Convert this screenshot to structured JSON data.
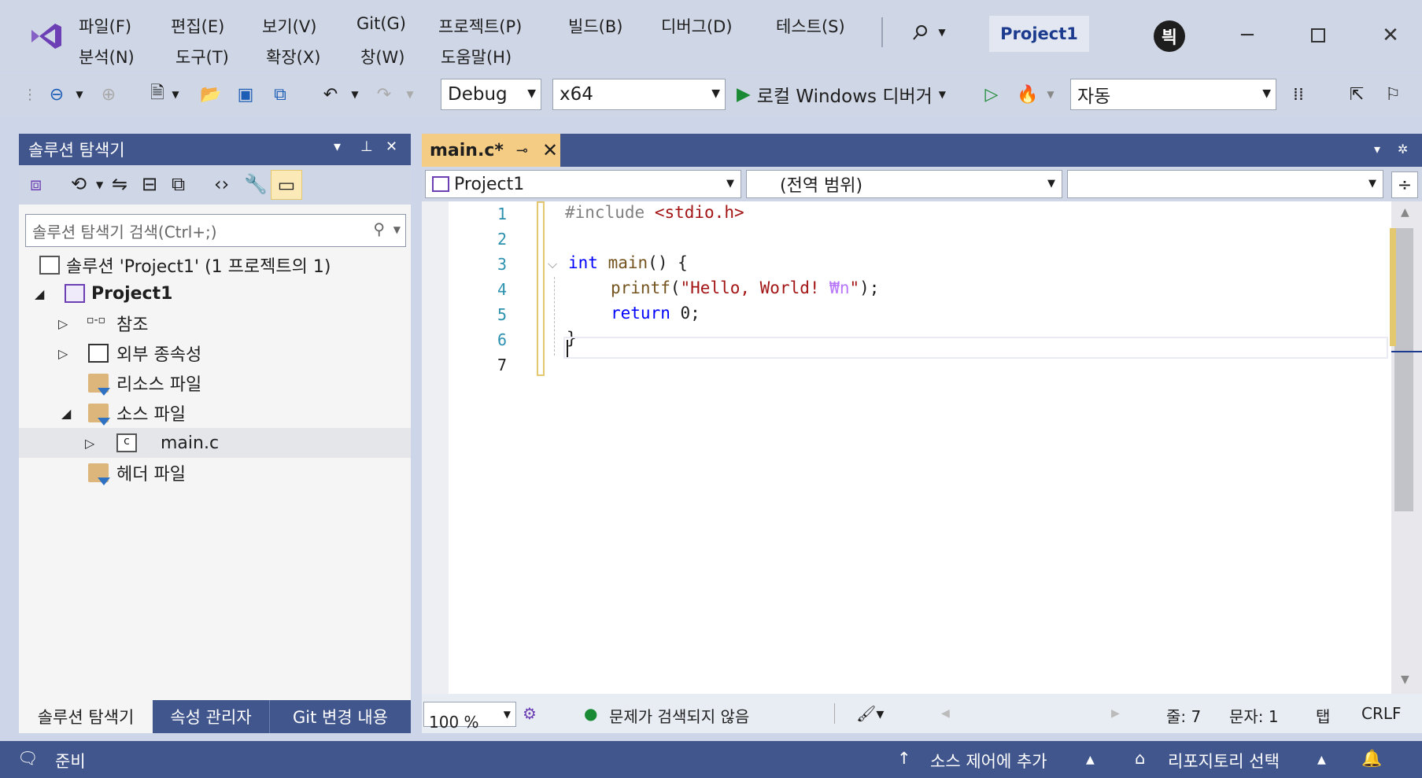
{
  "menu": {
    "row1": [
      "파일(F)",
      "편집(E)",
      "보기(V)",
      "Git(G)",
      "프로젝트(P)",
      "빌드(B)",
      "디버그(D)",
      "테스트(S)"
    ],
    "row2": [
      "분석(N)",
      "도구(T)",
      "확장(X)",
      "창(W)",
      "도움말(H)"
    ]
  },
  "title": {
    "project": "Project1",
    "avatar_initial": "븩"
  },
  "toolbar": {
    "config": "Debug",
    "platform": "x64",
    "run_label": "로컬 Windows 디버거",
    "auto_combo": "자동"
  },
  "solution_explorer": {
    "title": "솔루션 탐색기",
    "search_placeholder": "솔루션 탐색기 검색(Ctrl+;)",
    "items": [
      {
        "label": "솔루션 'Project1' (1 프로젝트의 1)"
      },
      {
        "label": "Project1"
      },
      {
        "label": "참조"
      },
      {
        "label": "외부 종속성"
      },
      {
        "label": "리소스 파일"
      },
      {
        "label": "소스 파일"
      },
      {
        "label": "main.c"
      },
      {
        "label": "헤더 파일"
      }
    ],
    "tabs": [
      "솔루션 탐색기",
      "속성 관리자",
      "Git 변경 내용"
    ]
  },
  "editor": {
    "tab_label": "main.c*",
    "nav_project": "Project1",
    "nav_scope": "(전역 범위)",
    "line_numbers": [
      "1",
      "2",
      "3",
      "4",
      "5",
      "6",
      "7"
    ],
    "code": {
      "l1_directive": "#include",
      "l1_header": "<stdio.h>",
      "l3_type": "int",
      "l3_name": "main",
      "l3_rest": "() {",
      "l4_func": "printf",
      "l4_open": "(",
      "l4_string": "\"Hello, World! ",
      "l4_escape": "₩n",
      "l4_string_end": "\"",
      "l4_close": ");",
      "l5_kw": "return",
      "l5_rest": " 0;",
      "l6": "}"
    },
    "status": {
      "zoom": "100 %",
      "issues": "문제가 검색되지 않음",
      "line": "줄: 7",
      "char": "문자: 1",
      "tab": "탭",
      "eol": "CRLF"
    }
  },
  "statusbar": {
    "ready": "준비",
    "source_control": "소스 제어에 추가",
    "repo": "리포지토리 선택"
  },
  "colors": {
    "accent": "#40568d",
    "tab_active": "#f5cc84",
    "chrome": "#cfd6e5"
  }
}
